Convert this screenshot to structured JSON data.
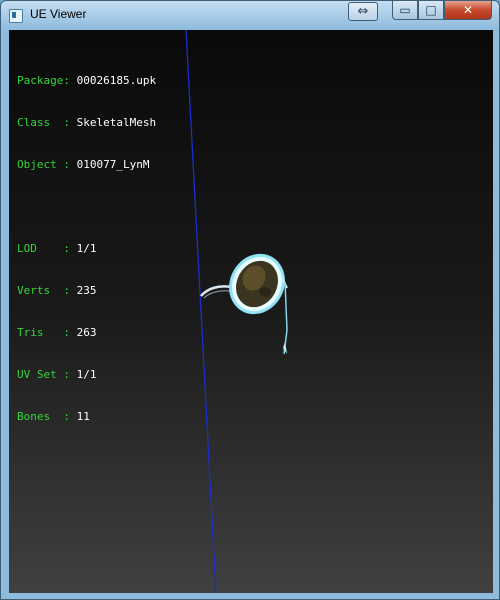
{
  "window": {
    "title": "UE Viewer",
    "title_icon": "app-icon",
    "controls": {
      "restore_arrows": "⇔",
      "minimize": "▭",
      "maximize": "□",
      "close": "✕"
    }
  },
  "info": {
    "package_label": "Package: ",
    "package_value": "00026185.upk",
    "class_label": "Class  : ",
    "class_value": "SkeletalMesh",
    "object_label": "Object : ",
    "object_value": "010077_LynM",
    "lod_label": "LOD    : ",
    "lod_value": "1/1",
    "verts_label": "Verts  : ",
    "verts_value": "235",
    "tris_label": "Tris   : ",
    "tris_value": "263",
    "uvset_label": "UV Set : ",
    "uvset_value": "1/1",
    "bones_label": "Bones  : ",
    "bones_value": "11"
  },
  "colors": {
    "label": "#34d53a",
    "value": "#ffffff",
    "axis_line": "#1a2fc8",
    "mesh_rim": "#8fe3f4"
  }
}
